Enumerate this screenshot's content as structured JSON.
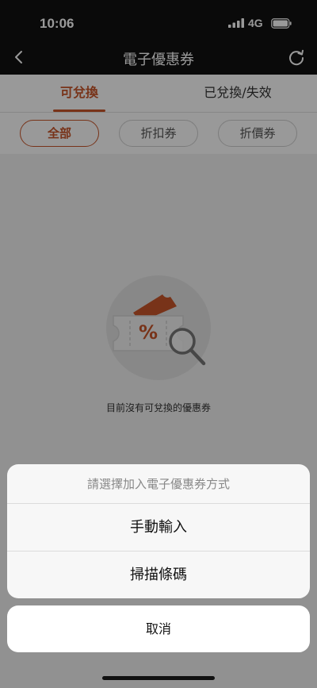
{
  "status_bar": {
    "time": "10:06",
    "network": "4G",
    "icons": [
      "signal-icon",
      "battery-icon"
    ]
  },
  "nav": {
    "title": "電子優惠券",
    "icons": [
      "chevron-left-icon",
      "refresh-icon"
    ]
  },
  "tabs": [
    {
      "label": "可兌換",
      "selected": true
    },
    {
      "label": "已兌換/失效",
      "selected": false
    }
  ],
  "filters": [
    {
      "label": "全部",
      "selected": true
    },
    {
      "label": "折扣券",
      "selected": false
    },
    {
      "label": "折價券",
      "selected": false
    }
  ],
  "empty_state": {
    "message": "目前沒有可兌換的優惠券",
    "illustration_glyph": "%",
    "icons": [
      "coupon-ticket-icon",
      "magnifier-icon"
    ]
  },
  "action_sheet": {
    "title": "請選擇加入電子優惠券方式",
    "options": [
      "手動輸入",
      "掃描條碼"
    ],
    "cancel_label": "取消"
  },
  "colors": {
    "accent": "#c8562a",
    "dark_bar": "#111111",
    "overlay": "rgba(0,0,0,0.40)"
  }
}
